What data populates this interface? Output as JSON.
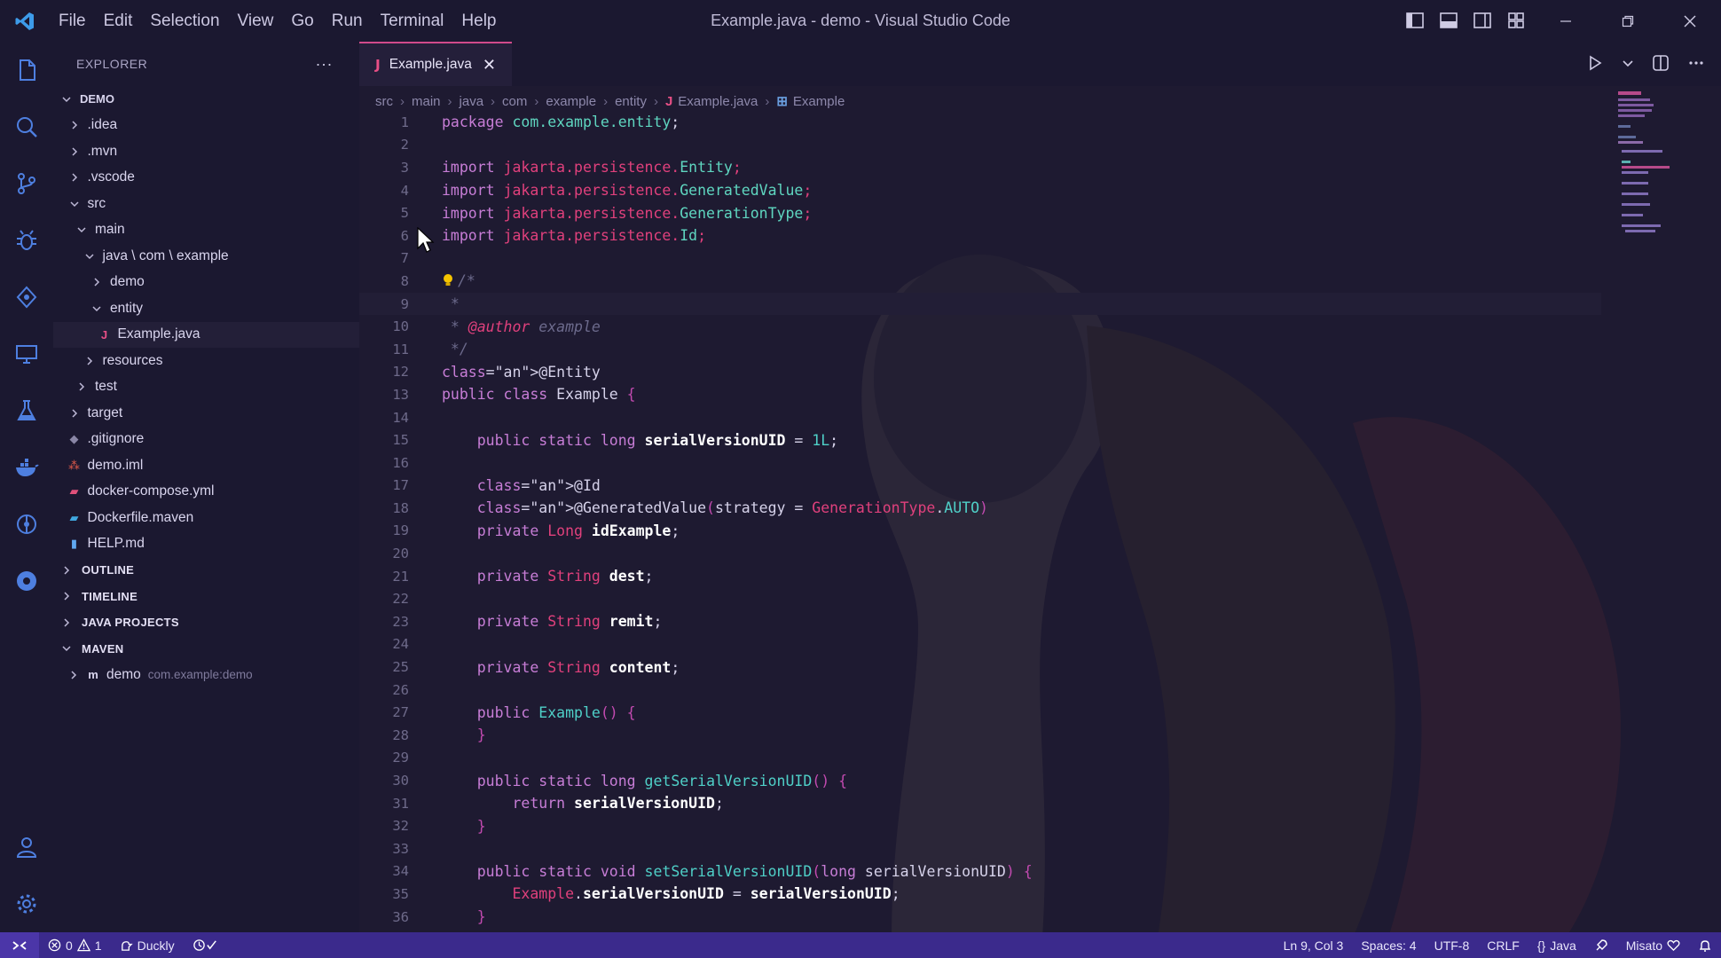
{
  "window": {
    "title": "Example.java - demo - Visual Studio Code",
    "menu": [
      "File",
      "Edit",
      "Selection",
      "View",
      "Go",
      "Run",
      "Terminal",
      "Help"
    ]
  },
  "activity_bar": {
    "items": [
      "explorer-icon",
      "search-icon",
      "source-control-icon",
      "debug-icon",
      "remote-explorer-icon",
      "remote-screen-icon",
      "testing-icon",
      "docker-icon",
      "gitlens-icon",
      "extensions-icon"
    ],
    "bottom": [
      "account-icon",
      "gear-icon"
    ]
  },
  "sidebar": {
    "header": "EXPLORER",
    "more": "···",
    "tree": [
      {
        "label": "DEMO",
        "indent": 0,
        "kind": "root",
        "open": true
      },
      {
        "label": ".idea",
        "indent": 1,
        "kind": "folder",
        "open": false
      },
      {
        "label": ".mvn",
        "indent": 1,
        "kind": "folder",
        "open": false
      },
      {
        "label": ".vscode",
        "indent": 1,
        "kind": "folder",
        "open": false
      },
      {
        "label": "src",
        "indent": 1,
        "kind": "folder",
        "open": true
      },
      {
        "label": "main",
        "indent": 2,
        "kind": "folder",
        "open": true
      },
      {
        "label": "java \\ com \\ example",
        "indent": 3,
        "kind": "folder",
        "open": true
      },
      {
        "label": "demo",
        "indent": 4,
        "kind": "folder",
        "open": false
      },
      {
        "label": "entity",
        "indent": 4,
        "kind": "folder",
        "open": true
      },
      {
        "label": "Example.java",
        "indent": 5,
        "kind": "java",
        "selected": true
      },
      {
        "label": "resources",
        "indent": 3,
        "kind": "folder",
        "open": false
      },
      {
        "label": "test",
        "indent": 2,
        "kind": "folder",
        "open": false
      },
      {
        "label": "target",
        "indent": 1,
        "kind": "folder",
        "open": false
      },
      {
        "label": ".gitignore",
        "indent": 1,
        "kind": "git"
      },
      {
        "label": "demo.iml",
        "indent": 1,
        "kind": "iml"
      },
      {
        "label": "docker-compose.yml",
        "indent": 1,
        "kind": "docker"
      },
      {
        "label": "Dockerfile.maven",
        "indent": 1,
        "kind": "dockerfile"
      },
      {
        "label": "HELP.md",
        "indent": 1,
        "kind": "md"
      }
    ],
    "sections": [
      "OUTLINE",
      "TIMELINE",
      "JAVA PROJECTS",
      "MAVEN"
    ],
    "maven_item": {
      "label": "demo",
      "detail": "com.example:demo"
    }
  },
  "editor": {
    "tab": {
      "label": "Example.java",
      "icon": "J",
      "close": "✕"
    },
    "breadcrumb": [
      "src",
      "main",
      "java",
      "com",
      "example",
      "entity",
      "Example.java",
      "Example"
    ],
    "lines": [
      "package com.example.entity;",
      "",
      "import jakarta.persistence.Entity;",
      "import jakarta.persistence.GeneratedValue;",
      "import jakarta.persistence.GenerationType;",
      "import jakarta.persistence.Id;",
      "",
      "/*",
      " *",
      " * @author example",
      " */",
      "@Entity",
      "public class Example {",
      "",
      "    public static long serialVersionUID = 1L;",
      "",
      "    @Id",
      "    @GeneratedValue(strategy = GenerationType.AUTO)",
      "    private Long idExample;",
      "",
      "    private String dest;",
      "",
      "    private String remit;",
      "",
      "    private String content;",
      "",
      "    public Example() {",
      "    }",
      "",
      "    public static long getSerialVersionUID() {",
      "        return serialVersionUID;",
      "    }",
      "",
      "    public static void setSerialVersionUID(long serialVersionUID) {",
      "        Example.serialVersionUID = serialVersionUID;",
      "    }"
    ],
    "current_line": 9
  },
  "status_bar": {
    "errors": "0",
    "warnings": "1",
    "profile": "Duckly",
    "position": "Ln 9, Col 3",
    "spaces": "Spaces: 4",
    "encoding": "UTF-8",
    "eol": "CRLF",
    "language": "Java",
    "theme": "Misato",
    "colors": {
      "bar": "#3b2a8c",
      "remote": "#4b36a8"
    }
  }
}
